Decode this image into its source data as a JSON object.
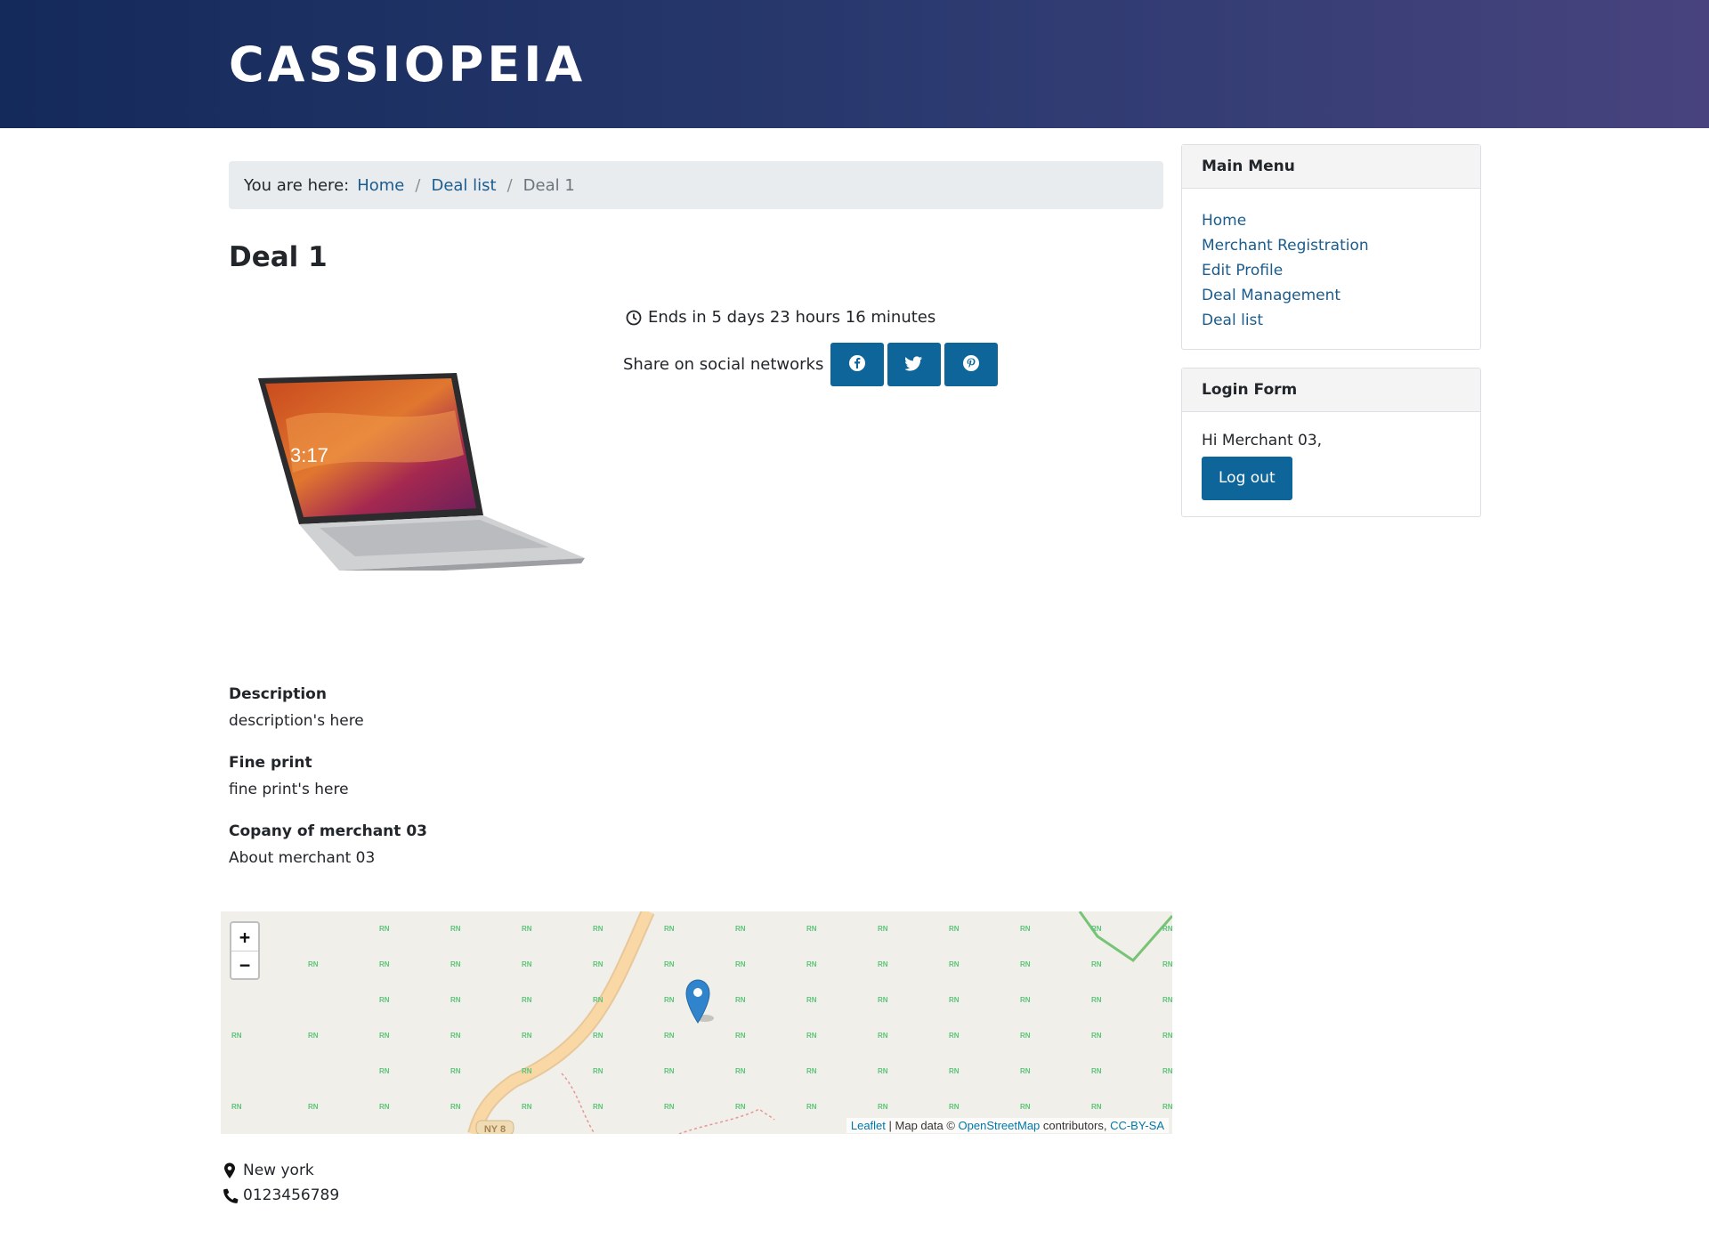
{
  "site": {
    "title": "CASSIOPEIA"
  },
  "breadcrumb": {
    "label": "You are here:",
    "items": [
      "Home",
      "Deal list"
    ],
    "current": "Deal 1"
  },
  "deal": {
    "title": "Deal 1",
    "countdown": "Ends in 5 days 23 hours 16 minutes",
    "share_label": "Share on social networks",
    "share_buttons": [
      "facebook-icon",
      "twitter-icon",
      "pinterest-icon"
    ],
    "description_heading": "Description",
    "description": "description's here",
    "fine_print_heading": "Fine print",
    "fine_print": "fine print's here",
    "company_heading": "Copany of merchant 03",
    "company_about": "About merchant 03",
    "location": "New york",
    "phone": "0123456789"
  },
  "map": {
    "zoom_in": "+",
    "zoom_out": "−",
    "road_label": "NY 8",
    "poi_label": "RN",
    "attribution": {
      "leaflet": "Leaflet",
      "map_data": " | Map data © ",
      "osm": "OpenStreetMap",
      "contributors": " contributors, ",
      "license": "CC-BY-SA"
    }
  },
  "sidebar": {
    "main_menu": {
      "title": "Main Menu",
      "items": [
        "Home",
        "Merchant Registration",
        "Edit Profile",
        "Deal Management",
        "Deal list"
      ]
    },
    "login": {
      "title": "Login Form",
      "greeting": "Hi Merchant 03,",
      "logout_label": "Log out"
    }
  },
  "colors": {
    "header_start": "#142a5a",
    "header_end": "#48437e",
    "link": "#1b5c8c",
    "button": "#0e6599"
  }
}
